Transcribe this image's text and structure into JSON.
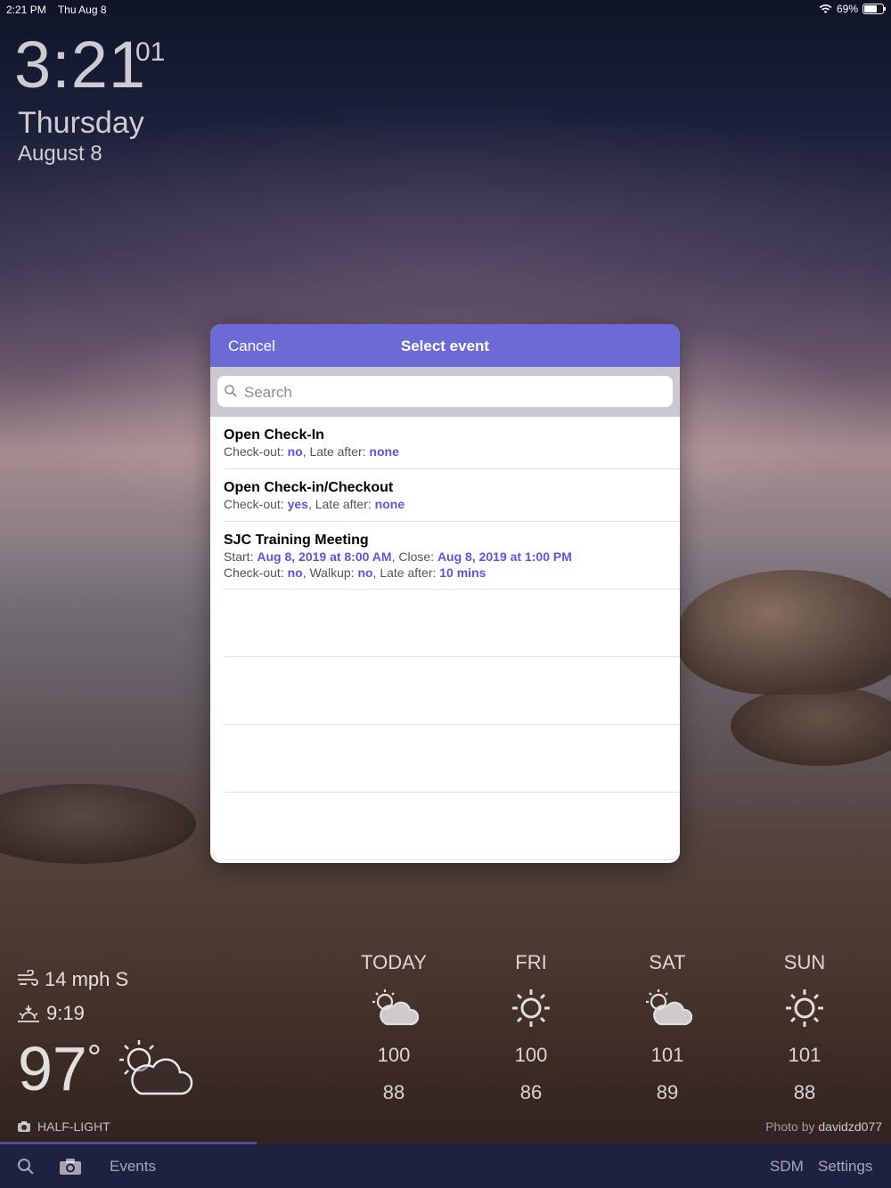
{
  "status_bar": {
    "time": "2:21 PM",
    "date": "Thu Aug 8",
    "battery": "69%"
  },
  "clock": {
    "time": "3:21",
    "seconds": "01",
    "day": "Thursday",
    "date": "August 8"
  },
  "modal": {
    "cancel_label": "Cancel",
    "title": "Select event",
    "search_placeholder": "Search",
    "accent_color": "#6c6bd6",
    "events": [
      {
        "name": "Open Check-In",
        "line1": {
          "checkout_label": "Check-out:",
          "checkout": "no",
          "late_label": ", Late after:",
          "late": "none"
        }
      },
      {
        "name": "Open Check-in/Checkout",
        "line1": {
          "checkout_label": "Check-out:",
          "checkout": "yes",
          "late_label": ", Late after:",
          "late": "none"
        }
      },
      {
        "name": "SJC Training Meeting",
        "line1": {
          "start_label": "Start:",
          "start": "Aug 8, 2019 at 8:00 AM",
          "close_label": ", Close:",
          "close": "Aug 8, 2019 at 1:00 PM"
        },
        "line2": {
          "checkout_label": "Check-out:",
          "checkout": "no",
          "walkup_label": ", Walkup:",
          "walkup": "no",
          "late_label": ", Late after:",
          "late": "10 mins"
        }
      }
    ]
  },
  "weather": {
    "wind": "14 mph S",
    "sunset": "9:19",
    "temperature": "97",
    "degree": "°",
    "forecast": [
      {
        "day": "TODAY",
        "icon": "partly-cloudy-icon",
        "high": "100",
        "low": "88"
      },
      {
        "day": "FRI",
        "icon": "sun-icon",
        "high": "100",
        "low": "86"
      },
      {
        "day": "SAT",
        "icon": "partly-cloudy-icon",
        "high": "101",
        "low": "89"
      },
      {
        "day": "SUN",
        "icon": "sun-icon",
        "high": "101",
        "low": "88"
      }
    ]
  },
  "half_light_label": "HALF-LIGHT",
  "photo_credit": {
    "prefix": "Photo by ",
    "author": "davidzd077"
  },
  "tab_bar": {
    "events": "Events",
    "sdm": "SDM",
    "settings": "Settings"
  }
}
